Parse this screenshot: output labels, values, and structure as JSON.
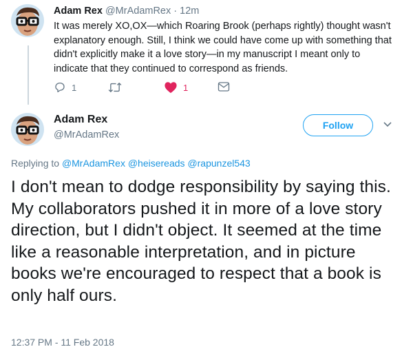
{
  "reply": {
    "author_name": "Adam Rex",
    "author_handle": "@MrAdamRex",
    "separator": "·",
    "time": "12m",
    "text": "It was merely XO,OX—which Roaring Brook (perhaps rightly) thought wasn't explanatory enough. Still, I think we could have come up with something that didn't explicitly make it a love story—in my manuscript I meant only to indicate that they continued to correspond as friends.",
    "actions": {
      "reply_count": "1",
      "retweet_count": "",
      "like_count": "1",
      "like_active": true
    }
  },
  "tweet": {
    "author_name": "Adam Rex",
    "author_handle": "@MrAdamRex",
    "follow_label": "Follow",
    "replying_prefix": "Replying to",
    "mentions": [
      "@MrAdamRex",
      "@heisereads",
      "@rapunzel543"
    ],
    "text": "I don't mean to dodge responsibility by saying this. My collaborators pushed it in more of a love story direction, but I didn't object. It seemed at the time like a reasonable interpretation, and in picture books we're encouraged to respect that a book is only half ours.",
    "timestamp": "12:37 PM - 11 Feb 2018"
  },
  "icons": {
    "reply": "speech-bubble-icon",
    "retweet": "retweet-arrows-icon",
    "like": "heart-icon",
    "dm": "envelope-icon",
    "caret": "chevron-down-icon"
  },
  "colors": {
    "accent": "#1da1f2",
    "mention": "#1b95e0",
    "like": "#e0245e",
    "muted": "#657786",
    "text": "#14171a",
    "thread_line": "#ccd6dd"
  }
}
